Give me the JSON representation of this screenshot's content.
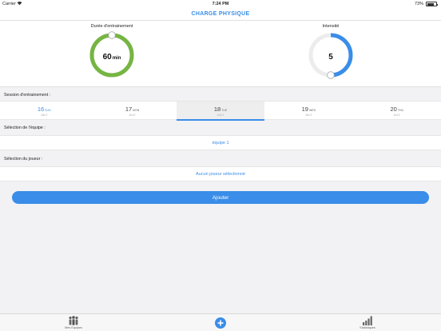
{
  "status_bar": {
    "carrier": "Carrier",
    "time": "7:24 PM",
    "battery": "73%",
    "battery_level": 0.73
  },
  "nav": {
    "title": "CHARGE PHYSIQUE"
  },
  "gauges": {
    "duration": {
      "label": "Durée d'entrainement",
      "value": "60",
      "unit": "min",
      "fraction": 1.0,
      "color": "#76b543"
    },
    "intensity": {
      "label": "Intensité",
      "value": "5",
      "fraction": 0.5,
      "color": "#3a8de8"
    }
  },
  "session": {
    "label": "Session d'entrainement :",
    "dates": [
      {
        "day": "16",
        "weekday": "SUN",
        "month": "JULY",
        "state": "today"
      },
      {
        "day": "17",
        "weekday": "MON",
        "month": "JULY",
        "state": ""
      },
      {
        "day": "18",
        "weekday": "TUE",
        "month": "JULY",
        "state": "selected"
      },
      {
        "day": "19",
        "weekday": "WED",
        "month": "JULY",
        "state": ""
      },
      {
        "day": "20",
        "weekday": "THU",
        "month": "JULY",
        "state": ""
      }
    ]
  },
  "team": {
    "label": "Sélection de l'équipe :",
    "value": "équipe 1"
  },
  "player": {
    "label": "Sélection du joueur :",
    "value": "Aucun joueur sélectionné"
  },
  "add_button": {
    "label": "Ajouter"
  },
  "tabs": {
    "teams": "Mes Equipes",
    "stats": "Statistiques"
  },
  "colors": {
    "accent": "#3a8de8",
    "green": "#76b543",
    "track": "#ececec"
  }
}
